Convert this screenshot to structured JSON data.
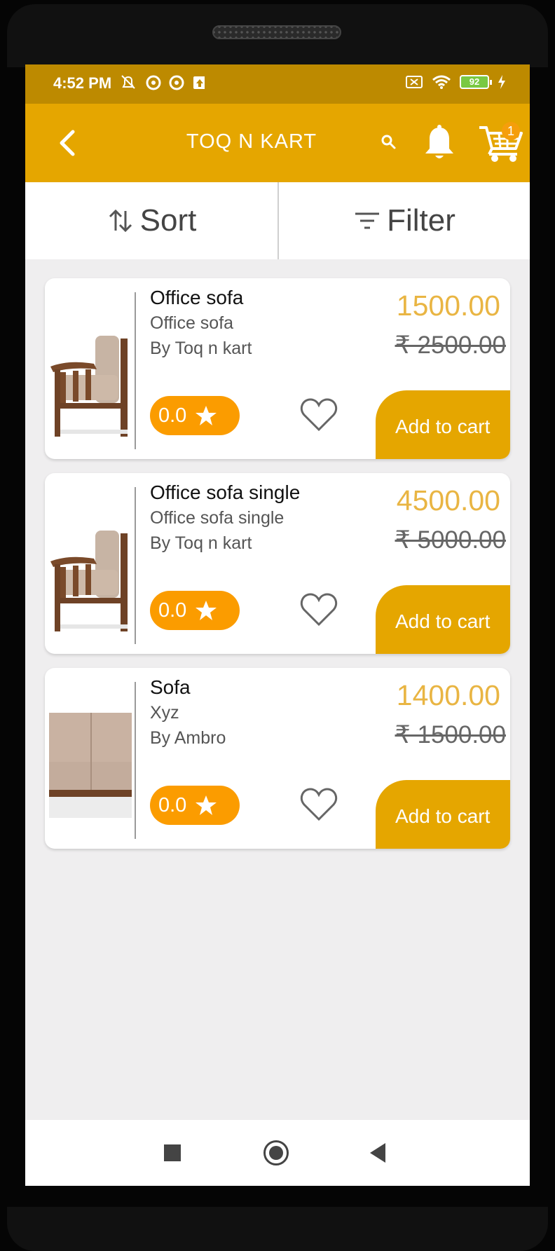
{
  "status_bar": {
    "time": "4:52 PM",
    "battery": "92"
  },
  "app_bar": {
    "title": "TOQ N KART",
    "cart_count": "1"
  },
  "toolbar": {
    "sort_label": "Sort",
    "filter_label": "Filter"
  },
  "products": [
    {
      "name": "Office sofa",
      "subtitle": "Office sofa",
      "seller": "By Toq n kart",
      "price": "1500.00",
      "mrp": "₹ 2500.00",
      "rating": "0.0",
      "add_to_cart": "Add to cart",
      "image": "armchair-image"
    },
    {
      "name": "Office sofa single",
      "subtitle": "Office sofa single",
      "seller": "By Toq n kart",
      "price": "4500.00",
      "mrp": "₹ 5000.00",
      "rating": "0.0",
      "add_to_cart": "Add to cart",
      "image": "armchair-image"
    },
    {
      "name": "Sofa",
      "subtitle": "Xyz",
      "seller": "By Ambro",
      "price": "1400.00",
      "mrp": "₹ 1500.00",
      "rating": "0.0",
      "add_to_cart": "Add to cart",
      "image": "sofa-image"
    }
  ],
  "colors": {
    "status_bar": "#bd8a00",
    "app_bar": "#e5a600",
    "rating_badge": "#fb9c00",
    "price": "#e9b543",
    "background": "#efeeef"
  }
}
